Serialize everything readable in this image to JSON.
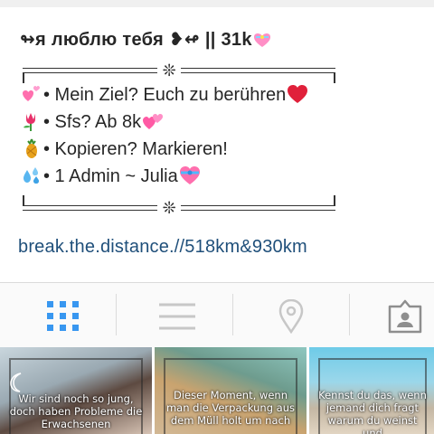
{
  "profile": {
    "name_prefix": "↬я люблю тебя ❥↫ || 31k",
    "bio_lines": [
      "• Mein Ziel? Euch zu berühren",
      "• Sfs? Ab 8k",
      "• Kopieren? Markieren!",
      "• 1 Admin ~ Julia"
    ],
    "border_ornament": "❊",
    "link": "break.the.distance.//518km&930km"
  },
  "icons": {
    "name_suffix": "heart-with-ribbon-icon",
    "line_icons": [
      "revolving-heart-icon",
      "tulip-icon",
      "pineapple-icon",
      "droplets-icon"
    ],
    "line_trailing": [
      "red-heart-icon",
      "two-hearts-icon",
      "",
      "heart-with-ribbon-icon"
    ]
  },
  "tabs": [
    "grid-view",
    "list-view",
    "location-view",
    "tagged-view"
  ],
  "colors": {
    "active_tab": "#3897f0",
    "inactive_tab": "#c7c7c7",
    "link": "#1f4f7a"
  },
  "posts": [
    {
      "caption": "Wir sind noch so jung, doch haben Probleme die Erwachsenen"
    },
    {
      "caption": "Dieser Moment, wenn man die Verpackung aus dem Müll holt um nach"
    },
    {
      "caption": "Kennst du das, wenn jemand dich fragt warum du weinst und"
    }
  ]
}
